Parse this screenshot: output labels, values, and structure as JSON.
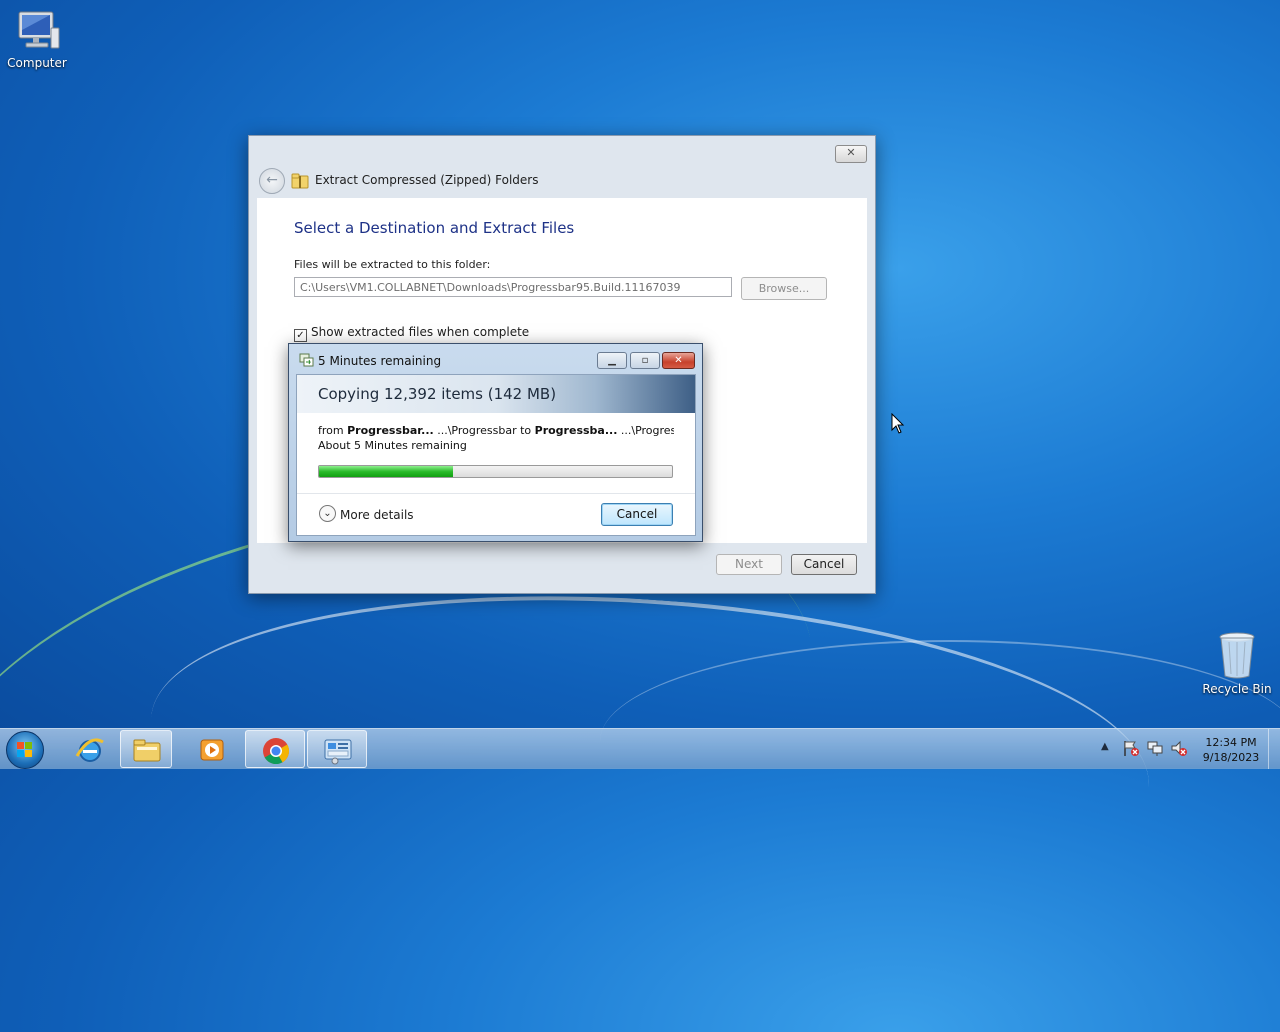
{
  "desktop": {
    "icons": [
      {
        "label": "Computer"
      },
      {
        "label": "Recycle Bin"
      }
    ]
  },
  "wizard": {
    "title": "Extract Compressed (Zipped) Folders",
    "close_icon": "close-icon",
    "heading": "Select a Destination and Extract Files",
    "folder_label": "Files will be extracted to this folder:",
    "folder_path": "C:\\Users\\VM1.COLLABNET\\Downloads\\Progressbar95.Build.11167039",
    "browse_label": "Browse...",
    "show_files_label": "Show extracted files when complete",
    "show_files_checked": true,
    "next_label": "Next",
    "cancel_label": "Cancel"
  },
  "copy_dialog": {
    "title": "5 Minutes remaining",
    "heading": "Copying 12,392 items (142 MB)",
    "from_word": "from",
    "source_name": "Progressbar...",
    "source_path": "...\\Progressbar",
    "to_word": "to",
    "dest_name": "Progressba...",
    "dest_path": "...\\Progressbar",
    "remaining": "About 5 Minutes remaining",
    "progress": 0.38,
    "more_details_label": "More details",
    "cancel_label": "Cancel"
  },
  "taskbar": {
    "items": [
      {
        "name": "internet-explorer-icon",
        "active": false
      },
      {
        "name": "file-explorer-icon",
        "active": true
      },
      {
        "name": "media-player-icon",
        "active": false
      },
      {
        "name": "chrome-icon",
        "active": true
      },
      {
        "name": "control-panel-icon",
        "active": true
      }
    ],
    "clock_time": "12:34 PM",
    "clock_date": "9/18/2023"
  },
  "colors": {
    "heading_blue": "#1e3287",
    "progress_green": "#2bbb2b",
    "desktop_blue": "#1c7bd3"
  }
}
